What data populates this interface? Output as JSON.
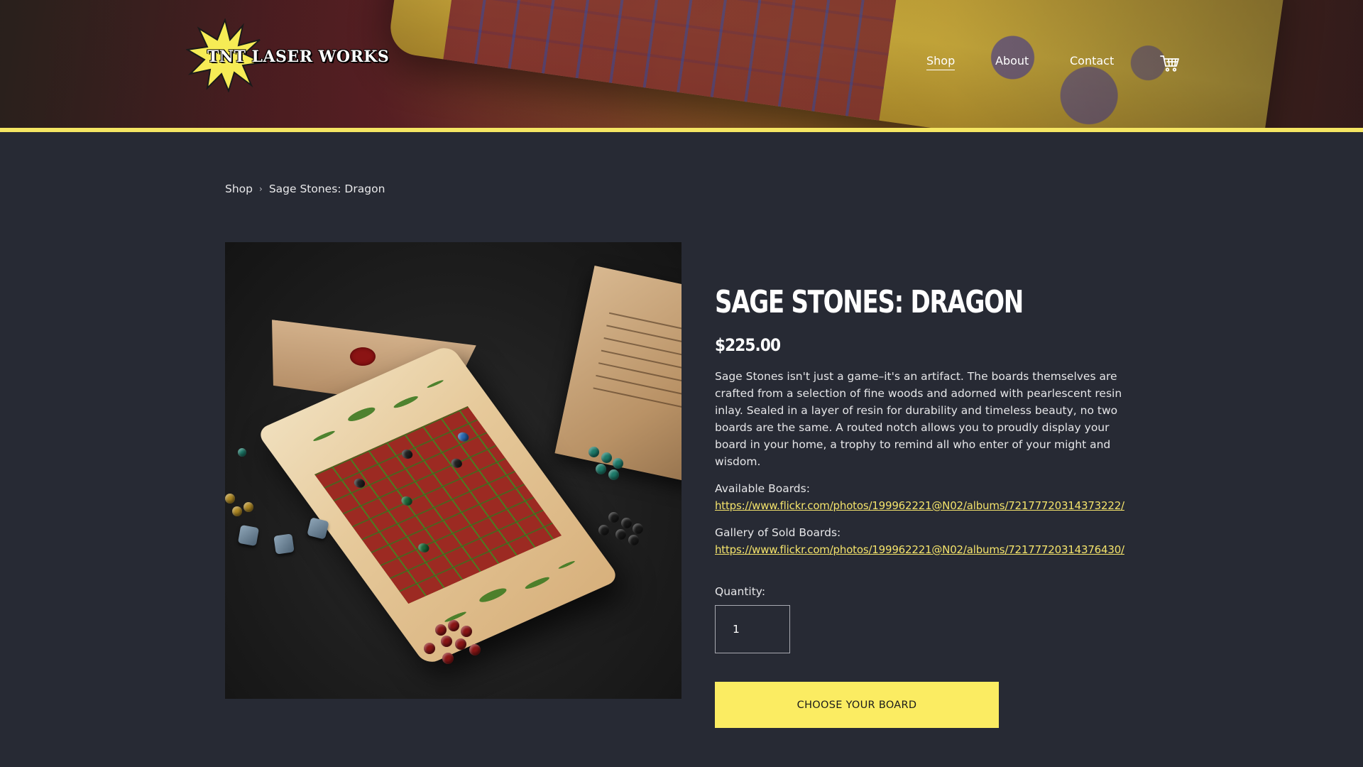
{
  "brand": {
    "logo_text": "TNT LASER WORKS",
    "accent_color": "#fbec62",
    "stripe_color": "#f5e663",
    "background_color": "#272a34"
  },
  "nav": {
    "items": [
      {
        "label": "Shop",
        "active": true
      },
      {
        "label": "About",
        "active": false
      },
      {
        "label": "Contact",
        "active": false
      }
    ],
    "cart_icon": "cart-icon"
  },
  "breadcrumb": {
    "items": [
      "Shop",
      "Sage Stones: Dragon"
    ],
    "separator": "›"
  },
  "product": {
    "title": "SAGE STONES: DRAGON",
    "price": "$225.00",
    "description": "Sage Stones isn't just a game–it's an artifact. The boards themselves are crafted from a selection of fine woods and adorned with pearlescent resin inlay. Sealed in a layer of resin for durability and timeless beauty, no two boards are the same. A routed notch allows you to proudly display your board in your home, a trophy to remind all who enter of your might and wisdom.",
    "available_label": "Available Boards:",
    "available_link": "https://www.flickr.com/photos/199962221@N02/albums/72177720314373222/",
    "gallery_label": "Gallery of Sold Boards:",
    "gallery_link": "https://www.flickr.com/photos/199962221@N02/albums/72177720314376430/",
    "quantity_label": "Quantity:",
    "quantity_value": "1",
    "cta_label": "CHOOSE YOUR BOARD"
  }
}
